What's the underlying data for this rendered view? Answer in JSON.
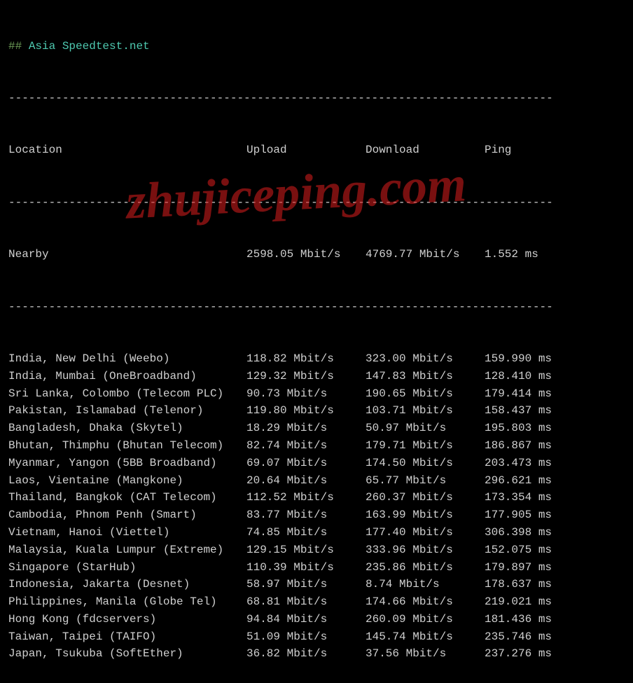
{
  "title_prefix": "##",
  "title": "Asia Speedtest.net",
  "headers": {
    "location": "Location",
    "upload": "Upload",
    "download": "Download",
    "ping": "Ping"
  },
  "nearby": {
    "label": "Nearby",
    "upload": "2598.05 Mbit/s",
    "download": "4769.77 Mbit/s",
    "ping": "1.552 ms"
  },
  "rows": [
    {
      "location": "India, New Delhi (Weebo)",
      "upload": "118.82 Mbit/s",
      "download": "323.00 Mbit/s",
      "ping": "159.990 ms"
    },
    {
      "location": "India, Mumbai (OneBroadband)",
      "upload": "129.32 Mbit/s",
      "download": "147.83 Mbit/s",
      "ping": "128.410 ms"
    },
    {
      "location": "Sri Lanka, Colombo (Telecom PLC)",
      "upload": "90.73 Mbit/s",
      "download": "190.65 Mbit/s",
      "ping": "179.414 ms"
    },
    {
      "location": "Pakistan, Islamabad (Telenor)",
      "upload": "119.80 Mbit/s",
      "download": "103.71 Mbit/s",
      "ping": "158.437 ms"
    },
    {
      "location": "Bangladesh, Dhaka (Skytel)",
      "upload": "18.29 Mbit/s",
      "download": "50.97 Mbit/s",
      "ping": "195.803 ms"
    },
    {
      "location": "Bhutan, Thimphu (Bhutan Telecom)",
      "upload": "82.74 Mbit/s",
      "download": "179.71 Mbit/s",
      "ping": "186.867 ms"
    },
    {
      "location": "Myanmar, Yangon (5BB Broadband)",
      "upload": "69.07 Mbit/s",
      "download": "174.50 Mbit/s",
      "ping": "203.473 ms"
    },
    {
      "location": "Laos, Vientaine (Mangkone)",
      "upload": "20.64 Mbit/s",
      "download": "65.77 Mbit/s",
      "ping": "296.621 ms"
    },
    {
      "location": "Thailand, Bangkok (CAT Telecom)",
      "upload": "112.52 Mbit/s",
      "download": "260.37 Mbit/s",
      "ping": "173.354 ms"
    },
    {
      "location": "Cambodia, Phnom Penh (Smart)",
      "upload": "83.77 Mbit/s",
      "download": "163.99 Mbit/s",
      "ping": "177.905 ms"
    },
    {
      "location": "Vietnam, Hanoi (Viettel)",
      "upload": "74.85 Mbit/s",
      "download": "177.40 Mbit/s",
      "ping": "306.398 ms"
    },
    {
      "location": "Malaysia, Kuala Lumpur (Extreme)",
      "upload": "129.15 Mbit/s",
      "download": "333.96 Mbit/s",
      "ping": "152.075 ms"
    },
    {
      "location": "Singapore (StarHub)",
      "upload": "110.39 Mbit/s",
      "download": "235.86 Mbit/s",
      "ping": "179.897 ms"
    },
    {
      "location": "Indonesia, Jakarta (Desnet)",
      "upload": "58.97 Mbit/s",
      "download": "8.74 Mbit/s",
      "ping": "178.637 ms"
    },
    {
      "location": "Philippines, Manila (Globe Tel)",
      "upload": "68.81 Mbit/s",
      "download": "174.66 Mbit/s",
      "ping": "219.021 ms"
    },
    {
      "location": "Hong Kong (fdcservers)",
      "upload": "94.84 Mbit/s",
      "download": "260.09 Mbit/s",
      "ping": "181.436 ms"
    },
    {
      "location": "Taiwan, Taipei (TAIFO)",
      "upload": "51.09 Mbit/s",
      "download": "145.74 Mbit/s",
      "ping": "235.746 ms"
    },
    {
      "location": "Japan, Tsukuba (SoftEther)",
      "upload": "36.82 Mbit/s",
      "download": "37.56 Mbit/s",
      "ping": "237.276 ms"
    }
  ],
  "watermark": "zhujiceping.com"
}
